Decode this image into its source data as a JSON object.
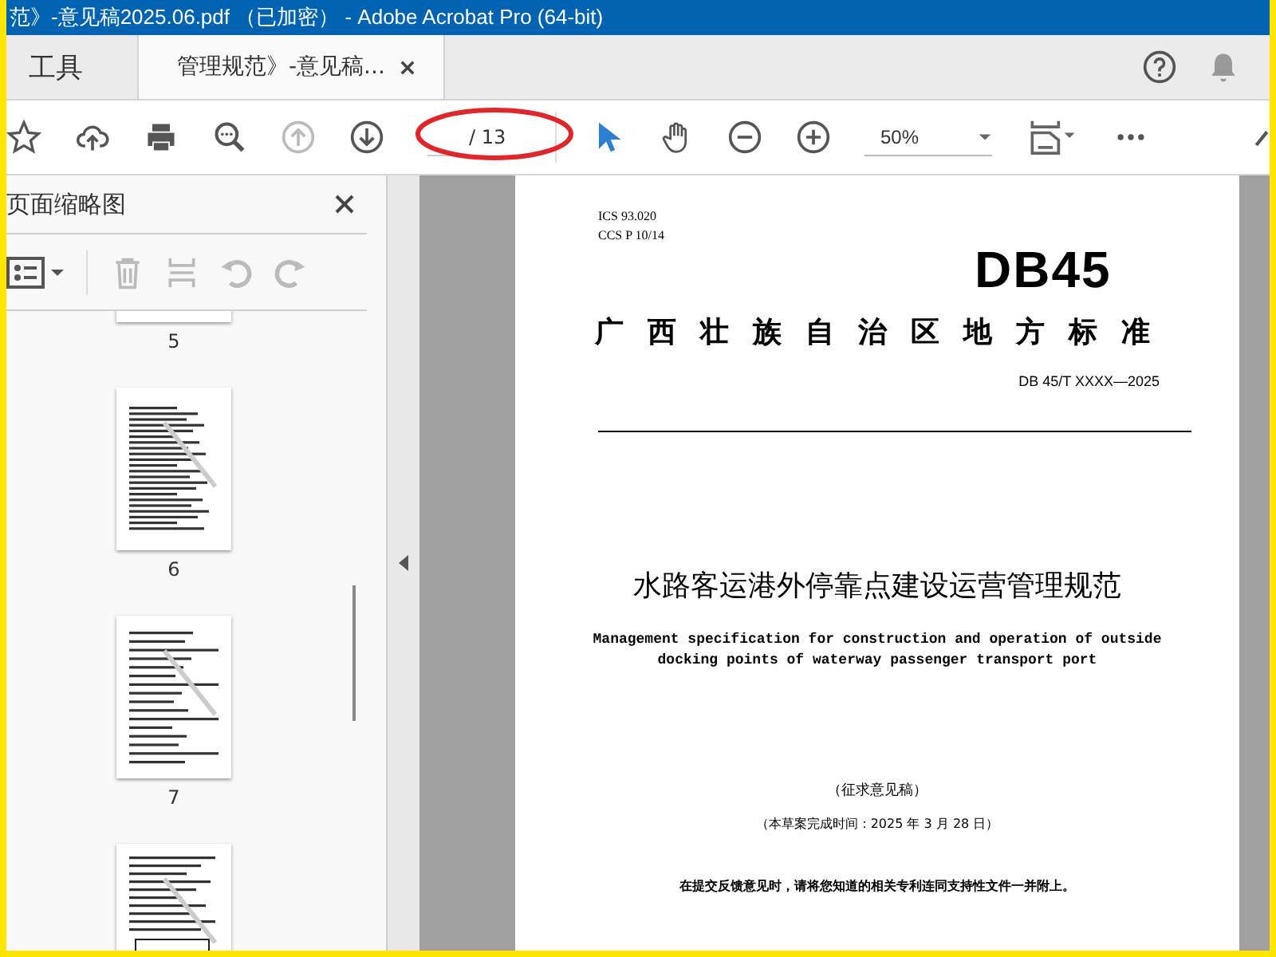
{
  "window": {
    "title": "范》-意见稿2025.06.pdf （已加密） - Adobe Acrobat Pro (64-bit)"
  },
  "tabs": [
    {
      "label": "工具",
      "selected": false
    },
    {
      "label": "管理规范》-意见稿...",
      "selected": true
    }
  ],
  "toolbar": {
    "page_total": "/ 13",
    "zoom": "50%",
    "previous_page_disabled": true
  },
  "thumbnails_panel": {
    "title": "页面缩略图",
    "pages": [
      {
        "label": "5",
        "kind": "cut"
      },
      {
        "label": "6",
        "kind": "text"
      },
      {
        "label": "7",
        "kind": "form"
      },
      {
        "kind": "table"
      }
    ]
  },
  "document": {
    "ics": "ICS 93.020",
    "ccs": "CCS P 10/14",
    "logo": "DB45",
    "heading": "广西壮族自治区地方标准",
    "code": "DB 45/T XXXX—2025",
    "title_cn": "水路客运港外停靠点建设运营管理规范",
    "title_en": "Management specification for construction and operation of outside docking points of waterway passenger transport port",
    "draft": "（征求意见稿）",
    "date": "（本草案完成时间：2025 年 3 月 28 日）",
    "notice": "在提交反馈意见时，请将您知道的相关专利连同支持性文件一并附上。"
  }
}
